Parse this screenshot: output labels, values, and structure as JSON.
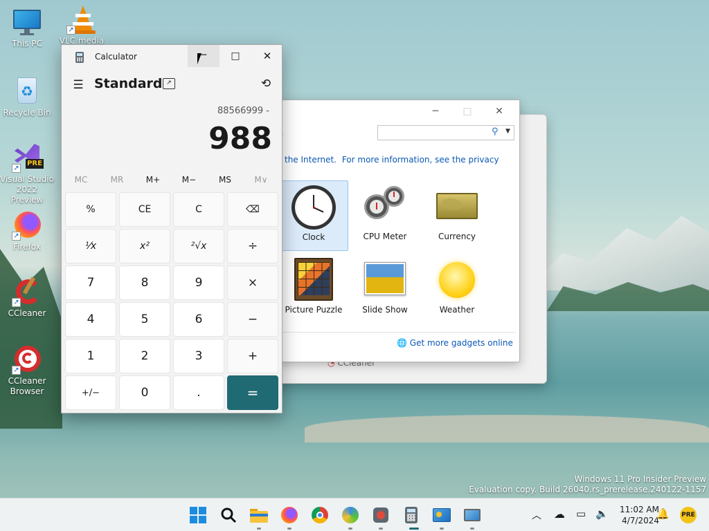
{
  "desktop": {
    "icons": [
      {
        "label": "This PC"
      },
      {
        "label": "VLC media"
      },
      {
        "label": "Recycle Bin"
      },
      {
        "label": "Visual Studio 2022 Preview"
      },
      {
        "label": "Firefox"
      },
      {
        "label": "CCleaner"
      },
      {
        "label": "CCleaner Browser"
      }
    ],
    "pre_badge": "PRE",
    "watermark": {
      "line1": "Windows 11 Pro Insider Preview",
      "line2": "Evaluation copy. Build 26040.rs_prerelease.240122-1157"
    },
    "partial_label": "CCleaner"
  },
  "gadgets_window": {
    "info_text": "the Internet.",
    "info_link": "For more information, see the privacy",
    "gadgets": [
      {
        "label": "Clock",
        "selected": true
      },
      {
        "label": "CPU Meter"
      },
      {
        "label": "Currency"
      },
      {
        "label": "Picture Puzzle"
      },
      {
        "label": "Slide Show"
      },
      {
        "label": "Weather"
      }
    ],
    "more_link": "Get more gadgets online",
    "search_placeholder": ""
  },
  "calculator": {
    "title": "Calculator",
    "mode": "Standard",
    "expression": "88566999 -",
    "display": "988",
    "memory": [
      "MC",
      "MR",
      "M+",
      "M−",
      "MS",
      "M∨"
    ],
    "memory_enabled": [
      false,
      false,
      true,
      true,
      true,
      false
    ],
    "buttons": [
      [
        "%",
        "CE",
        "C",
        "⌫"
      ],
      [
        "¹⁄x",
        "x²",
        "²√x",
        "÷"
      ],
      [
        "7",
        "8",
        "9",
        "×"
      ],
      [
        "4",
        "5",
        "6",
        "−"
      ],
      [
        "1",
        "2",
        "3",
        "+"
      ],
      [
        "+/−",
        "0",
        ".",
        "="
      ]
    ],
    "accent": "#1f6a73"
  },
  "taskbar": {
    "time": "11:02 AM",
    "date": "4/7/2024",
    "tray_badge": "PRE"
  }
}
